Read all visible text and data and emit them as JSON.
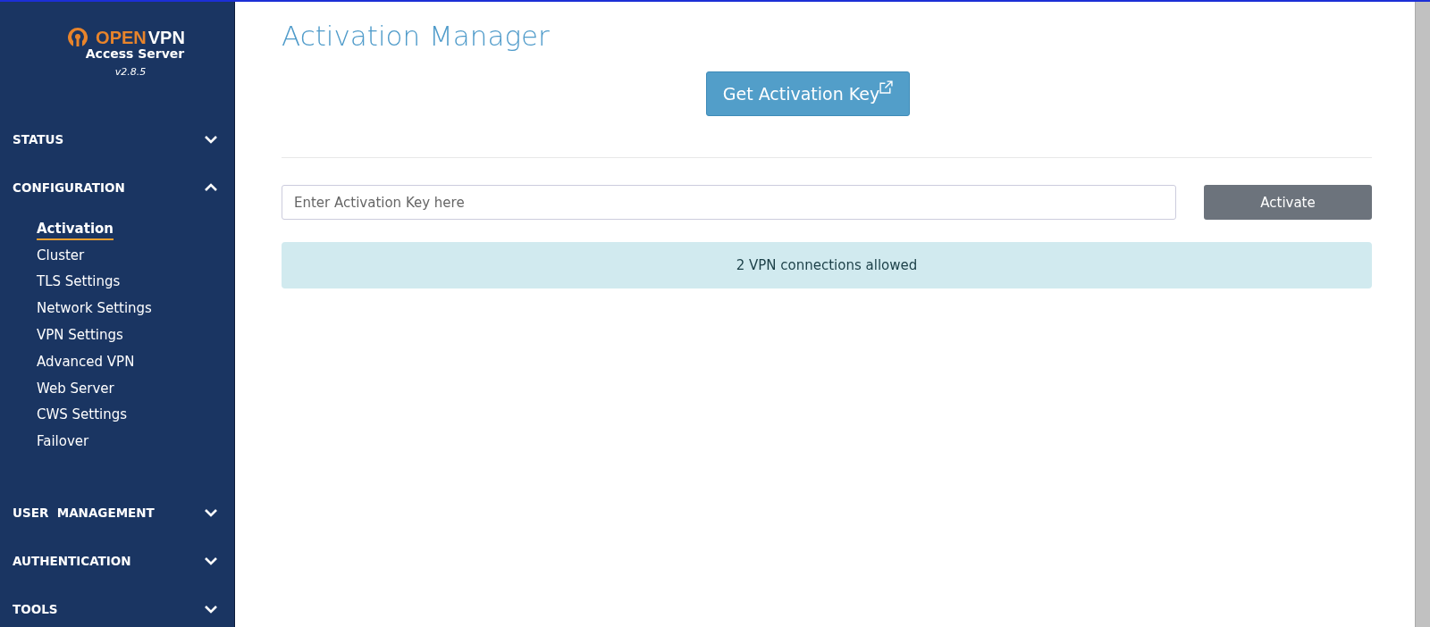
{
  "sidebar": {
    "logo": {
      "brand_first": "OPEN",
      "brand_second": "VPN",
      "product": "Access Server",
      "version": "v2.8.5"
    },
    "sections": [
      {
        "label": "STATUS",
        "expanded": false
      },
      {
        "label": "CONFIGURATION",
        "expanded": true,
        "items": [
          {
            "label": "Activation",
            "selected": true
          },
          {
            "label": "Cluster",
            "selected": false
          },
          {
            "label": "TLS Settings",
            "selected": false
          },
          {
            "label": "Network Settings",
            "selected": false
          },
          {
            "label": "VPN Settings",
            "selected": false
          },
          {
            "label": "Advanced VPN",
            "selected": false
          },
          {
            "label": "Web Server",
            "selected": false
          },
          {
            "label": "CWS Settings",
            "selected": false
          },
          {
            "label": "Failover",
            "selected": false
          }
        ]
      },
      {
        "label": "USER  MANAGEMENT",
        "expanded": false
      },
      {
        "label": "AUTHENTICATION",
        "expanded": false
      },
      {
        "label": "TOOLS",
        "expanded": false
      }
    ]
  },
  "main": {
    "title": "Activation Manager",
    "get_key_button": "Get Activation Key",
    "key_field": {
      "placeholder": "Enter Activation Key here"
    },
    "activate_button": "Activate",
    "alert": "2 VPN connections allowed"
  }
}
